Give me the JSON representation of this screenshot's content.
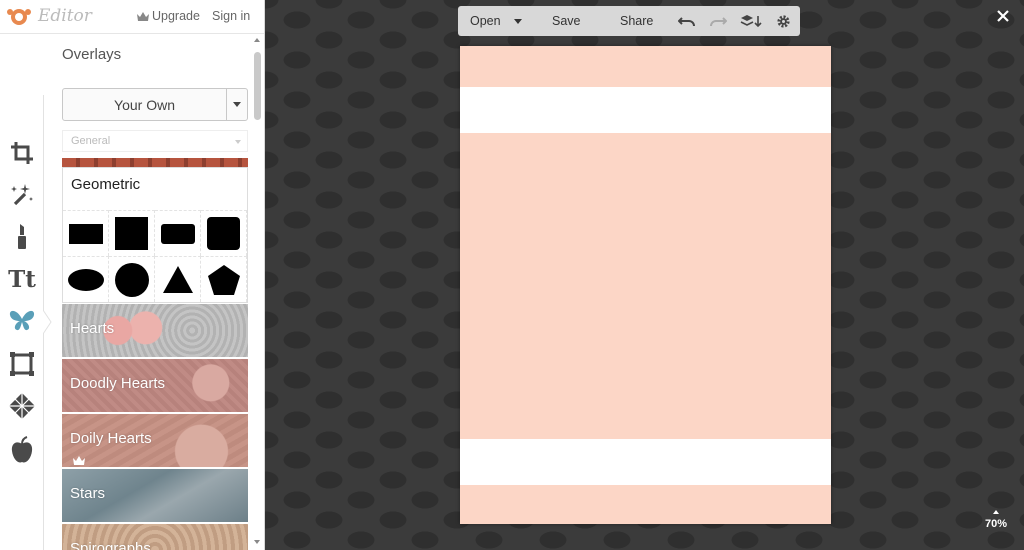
{
  "header": {
    "logo_text": "Editor",
    "upgrade_label": "Upgrade",
    "signin_label": "Sign in"
  },
  "tools": [
    {
      "name": "crop-icon"
    },
    {
      "name": "effects-wand-icon"
    },
    {
      "name": "touch-up-lipstick-icon"
    },
    {
      "name": "text-icon",
      "glyph": "Tt"
    },
    {
      "name": "overlays-butterfly-icon"
    },
    {
      "name": "frames-icon"
    },
    {
      "name": "textures-icon"
    },
    {
      "name": "themes-apple-icon"
    }
  ],
  "panel": {
    "title": "Overlays",
    "your_own_label": "Your Own",
    "category_select": "General",
    "geometric_title": "Geometric",
    "shapes": [
      "rectangle",
      "square",
      "rounded-rectangle",
      "rounded-square",
      "ellipse",
      "circle",
      "triangle",
      "pentagon"
    ],
    "categories": [
      {
        "label": "Hearts",
        "color": "#b9b9b9"
      },
      {
        "label": "Doodly Hearts",
        "color": "#c08b85"
      },
      {
        "label": "Doily Hearts",
        "color": "#c79487"
      },
      {
        "label": "Stars",
        "color": "#7b8f98"
      },
      {
        "label": "Spirographs",
        "color": "#c9a98e"
      }
    ]
  },
  "toolbar": {
    "open_label": "Open",
    "save_label": "Save",
    "share_label": "Share"
  },
  "zoom_label": "70%",
  "colors": {
    "canvas_fill": "#fcd6c6",
    "band_fill": "#ffffff",
    "accent_icon": "#5a9fb8"
  }
}
